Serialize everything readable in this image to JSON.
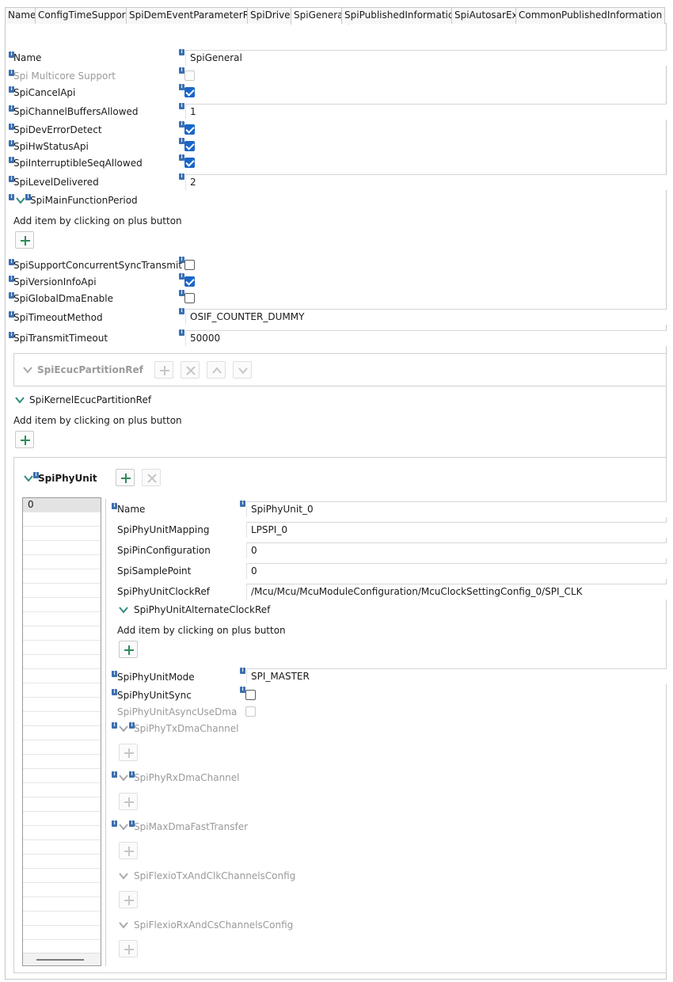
{
  "tabs": [
    {
      "label": "Name",
      "active": false
    },
    {
      "label": "ConfigTimeSupport",
      "active": false
    },
    {
      "label": "SpiDemEventParameterRefs",
      "active": false
    },
    {
      "label": "SpiDriver",
      "active": false
    },
    {
      "label": "SpiGeneral",
      "active": true
    },
    {
      "label": "SpiPublishedInformation",
      "active": false
    },
    {
      "label": "SpiAutosarExt",
      "active": false
    },
    {
      "label": "CommonPublishedInformation",
      "active": false
    }
  ],
  "general": {
    "name_label": "Name",
    "name_value": "SpiGeneral",
    "multicore_label": "Spi Multicore Support",
    "multicore_checked": false,
    "cancel_api_label": "SpiCancelApi",
    "cancel_api_checked": true,
    "channel_buffers_label": "SpiChannelBuffersAllowed",
    "channel_buffers_value": "1",
    "dev_error_label": "SpiDevErrorDetect",
    "dev_error_checked": true,
    "hw_status_label": "SpiHwStatusApi",
    "hw_status_checked": true,
    "interruptible_label": "SpiInterruptibleSeqAllowed",
    "interruptible_checked": true,
    "level_label": "SpiLevelDelivered",
    "level_value": "2",
    "main_function_label": "SpiMainFunctionPeriod",
    "add_item_hint": "Add item by clicking on plus button",
    "concurrent_label": "SpiSupportConcurrentSyncTransmit",
    "concurrent_checked": false,
    "version_info_label": "SpiVersionInfoApi",
    "version_info_checked": true,
    "global_dma_label": "SpiGlobalDmaEnable",
    "global_dma_checked": false,
    "timeout_method_label": "SpiTimeoutMethod",
    "timeout_method_value": "OSIF_COUNTER_DUMMY",
    "transmit_timeout_label": "SpiTransmitTimeout",
    "transmit_timeout_value": "50000",
    "ecuc_partition_label": "SpiEcucPartitionRef",
    "kernel_partition_label": "SpiKernelEcucPartitionRef",
    "kernel_add_hint": "Add item by clicking on plus button"
  },
  "phy_unit": {
    "title": "SpiPhyUnit",
    "list_items": [
      "0"
    ],
    "name_label": "Name",
    "name_value": "SpiPhyUnit_0",
    "mapping_label": "SpiPhyUnitMapping",
    "mapping_value": "LPSPI_0",
    "pin_config_label": "SpiPinConfiguration",
    "pin_config_value": "0",
    "sample_point_label": "SpiSamplePoint",
    "sample_point_value": "0",
    "clock_ref_label": "SpiPhyUnitClockRef",
    "clock_ref_value": "/Mcu/Mcu/McuModuleConfiguration/McuClockSettingConfig_0/SPI_CLK",
    "alt_clock_label": "SpiPhyUnitAlternateClockRef",
    "alt_clock_hint": "Add item by clicking on plus button",
    "mode_label": "SpiPhyUnitMode",
    "mode_value": "SPI_MASTER",
    "sync_label": "SpiPhyUnitSync",
    "sync_checked": false,
    "async_dma_label": "SpiPhyUnitAsyncUseDma",
    "async_dma_checked": false,
    "tx_dma_label": "SpiPhyTxDmaChannel",
    "rx_dma_label": "SpiPhyRxDmaChannel",
    "max_dma_label": "SpiMaxDmaFastTransfer",
    "flexio_tx_label": "SpiFlexioTxAndClkChannelsConfig",
    "flexio_rx_label": "SpiFlexioRxAndCsChannelsConfig"
  },
  "colors": {
    "accent": "#1a66c8",
    "chevron": "#2e8b7a",
    "plus": "#2e8b5a",
    "info": "#3c6fb0",
    "disabled": "#9a9a9a"
  }
}
